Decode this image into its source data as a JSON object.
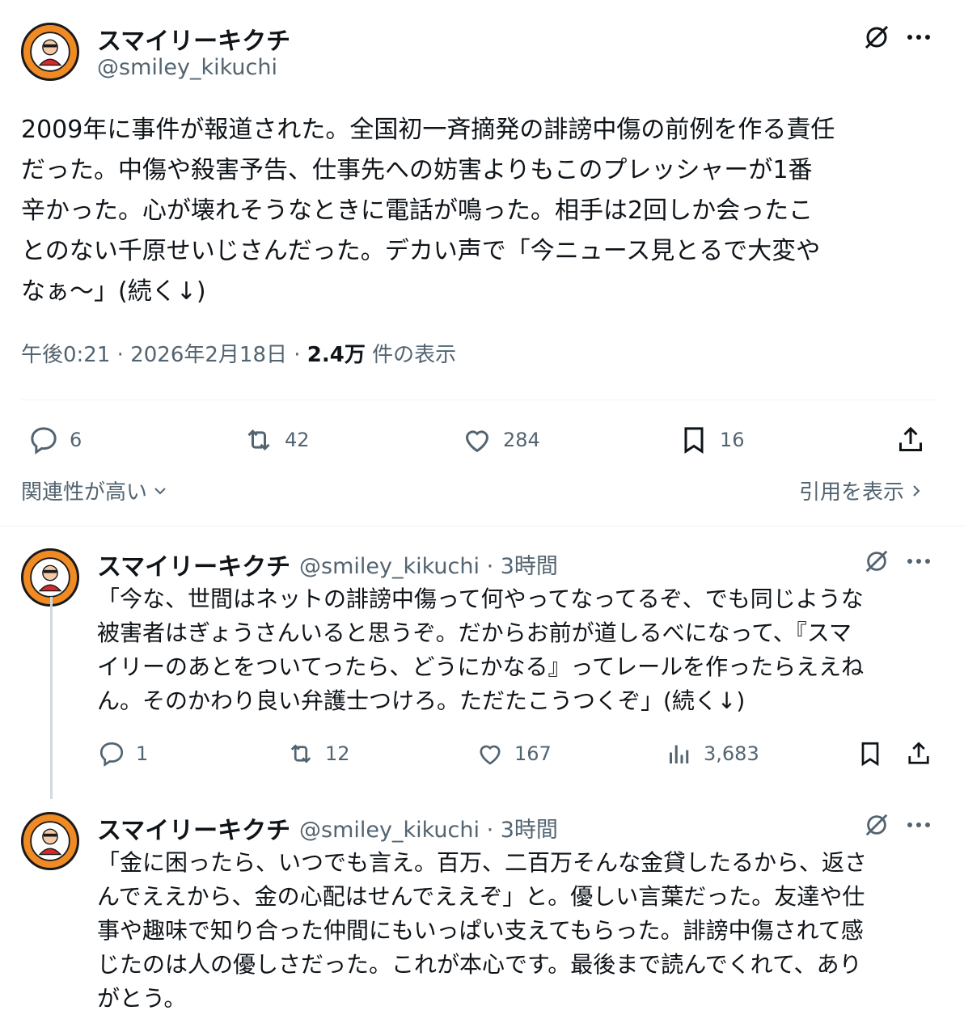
{
  "main_post": {
    "author_name": "スマイリーキクチ",
    "author_handle": "@smiley_kikuchi",
    "text_lines": [
      "2009年に事件が報道された。全国初一斉摘発の誹謗中傷の前例を作る責任",
      "だった。中傷や殺害予告、仕事先への妨害よりもこのプレッシャーが1番",
      "辛かった。心が壊れそうなときに電話が鳴った。相手は2回しか会ったこ",
      "とのない千原せいじさんだった。デカい声で「今ニュース見とるで大変や",
      "なぁ～」(続く↓)"
    ],
    "time": "午後0:21",
    "date": "2026年2月18日",
    "views_count": "2.4万",
    "views_label": "件の表示",
    "replies": "6",
    "reposts": "42",
    "likes": "284",
    "bookmarks": "16"
  },
  "sort_label": "関連性が高い",
  "quotes_label": "引用を表示",
  "replies": [
    {
      "author_name": "スマイリーキクチ",
      "author_handle": "@smiley_kikuchi",
      "time_ago": "3時間",
      "text_lines": [
        "「今な、世間はネットの誹謗中傷って何やってなってるぞ、でも同じような",
        "被害者はぎょうさんいると思うぞ。だからお前が道しるべになって、『スマ",
        "イリーのあとをついてったら、どうにかなる』ってレールを作ったらええね",
        "ん。そのかわり良い弁護士つけろ。ただたこうつくぞ」(続く↓)"
      ],
      "replies": "1",
      "reposts": "12",
      "likes": "167",
      "views": "3,683"
    },
    {
      "author_name": "スマイリーキクチ",
      "author_handle": "@smiley_kikuchi",
      "time_ago": "3時間",
      "text_lines": [
        "「金に困ったら、いつでも言え。百万、二百万そんな金貸したるから、返さ",
        "んでええから、金の心配はせんでええぞ」と。優しい言葉だった。友達や仕",
        "事や趣味で知り合った仲間にもいっぱい支えてもらった。誹謗中傷されて感",
        "じたのは人の優しさだった。これが本心です。最後まで読んでくれて、あり",
        "がとう。"
      ]
    }
  ],
  "colors": {
    "text": "#0f1419",
    "secondary": "#536471",
    "avatar_bg": "#f08a24",
    "divider": "#eff3f4"
  },
  "icons": [
    "grok-icon",
    "more-icon",
    "reply-icon",
    "repost-icon",
    "like-icon",
    "bookmark-icon",
    "share-icon",
    "views-icon",
    "chevron-down-icon",
    "chevron-right-icon"
  ]
}
